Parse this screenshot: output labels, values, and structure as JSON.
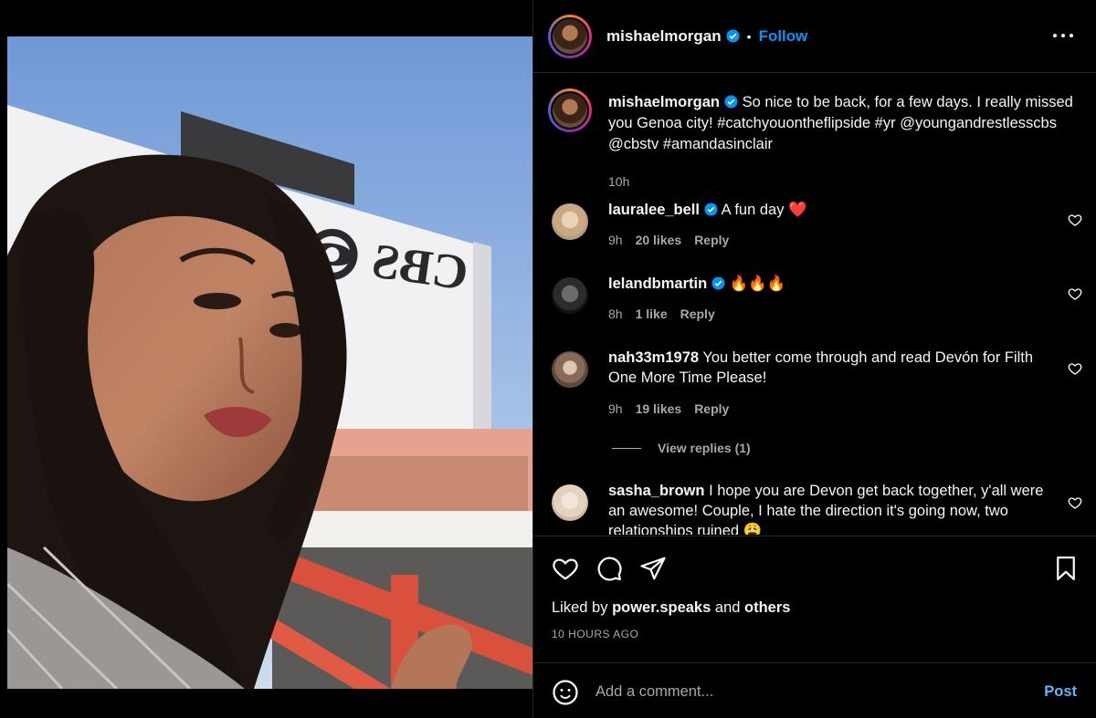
{
  "post": {
    "author": "mishaelmorgan",
    "follow_label": "Follow",
    "separator": "•"
  },
  "caption": {
    "username": "mishaelmorgan",
    "text": "So nice to be back, for a few days. I really missed you Genoa city! #catchyouontheflipside #yr @youngandrestlesscbs @cbstv #amandasinclair",
    "time": "10h"
  },
  "comments": [
    {
      "username": "lauralee_bell",
      "verified": true,
      "text": "A fun day ❤️",
      "time": "9h",
      "likes": "20 likes",
      "reply": "Reply"
    },
    {
      "username": "lelandbmartin",
      "verified": true,
      "text": "🔥🔥🔥",
      "time": "8h",
      "likes": "1 like",
      "reply": "Reply"
    },
    {
      "username": "nah33m1978",
      "verified": false,
      "text": "You better come through and read Devón for Filth One More Time Please!",
      "time": "9h",
      "likes": "19 likes",
      "reply": "Reply"
    },
    {
      "username": "sasha_brown",
      "verified": false,
      "text": "I hope you are Devon get back together, y'all were an awesome! Couple, I hate the direction it's going now, two relationships ruined 😩"
    }
  ],
  "view_replies": "View replies (1)",
  "likes": {
    "prefix": "Liked by",
    "user": "power.speaks",
    "and": "and",
    "others": "others"
  },
  "posted_ago": "10 HOURS AGO",
  "comment_box": {
    "placeholder": "Add a comment...",
    "post_label": "Post"
  },
  "photo": {
    "sign_text": "CBS"
  },
  "colors": {
    "accent": "#0095f6",
    "post_button": "#62b5f6",
    "verified": "#0095f6",
    "like_red": "#ed4956"
  },
  "icons": [
    "verified-icon",
    "more-icon",
    "heart-icon",
    "comment-icon",
    "share-icon",
    "bookmark-icon",
    "emoji-icon"
  ]
}
